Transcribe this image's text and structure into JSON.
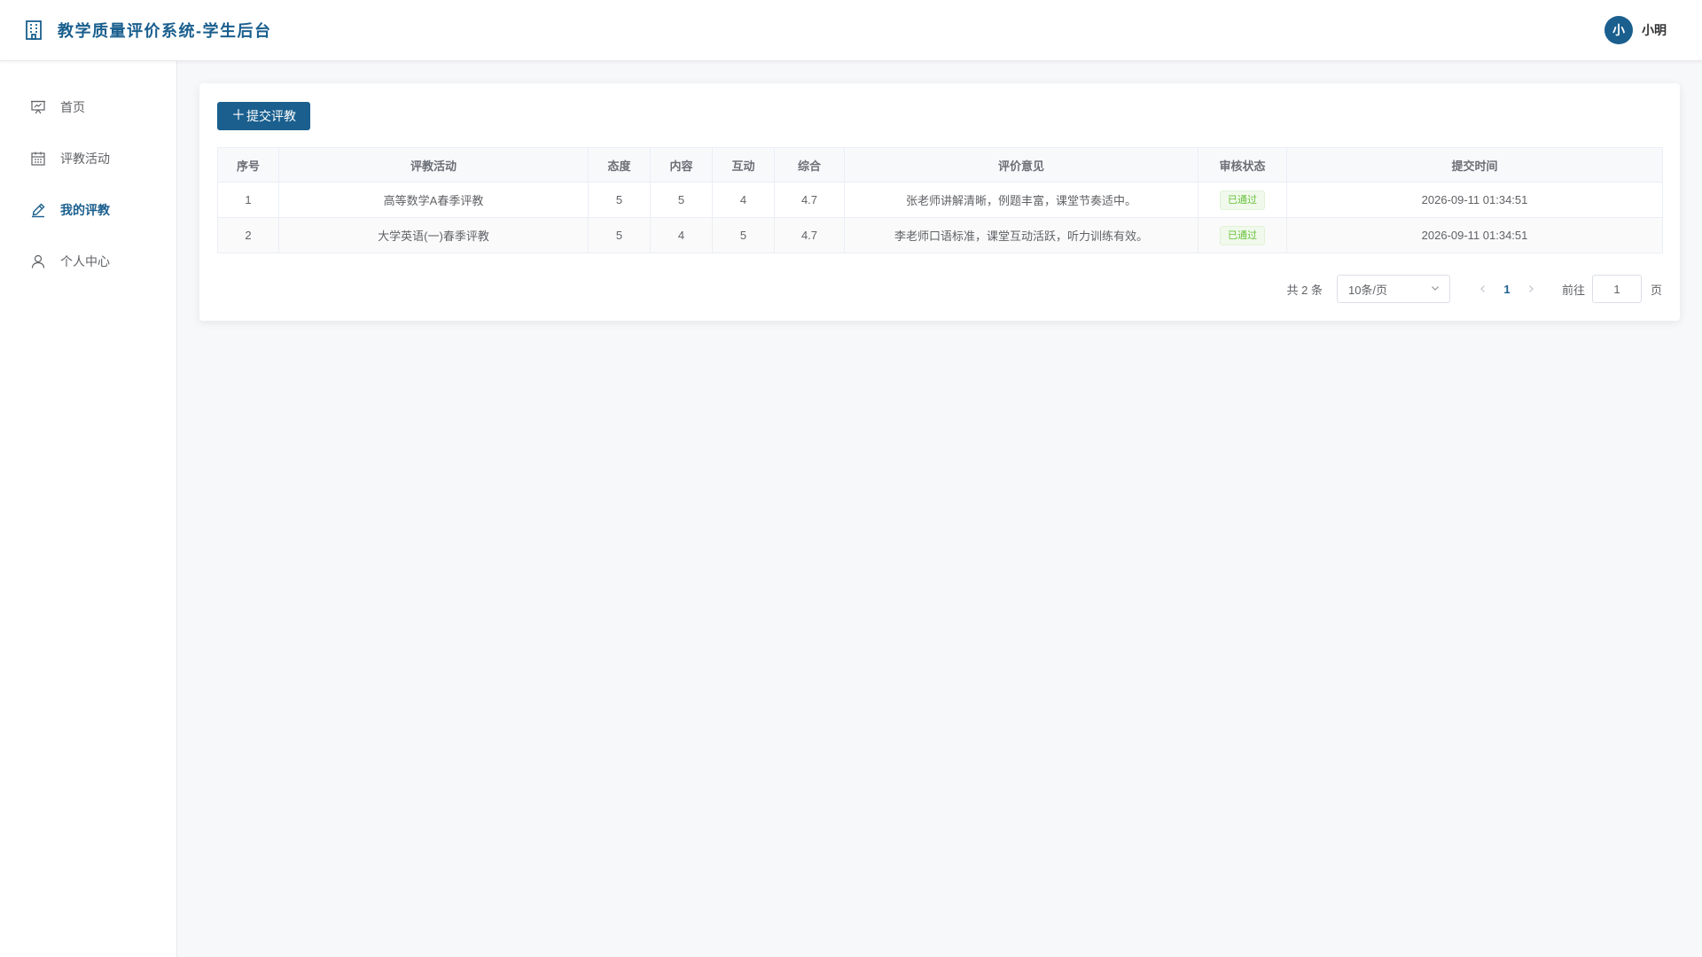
{
  "app": {
    "title": "教学质量评价系统-学生后台",
    "accent": "#1a5f8e",
    "icon": "building-icon"
  },
  "user": {
    "avatar_text": "小",
    "name": "小明"
  },
  "sidebar": {
    "items": [
      {
        "label": "首页",
        "icon": "presentation-icon",
        "active": false
      },
      {
        "label": "评教活动",
        "icon": "calendar-icon",
        "active": false
      },
      {
        "label": "我的评教",
        "icon": "pen-icon",
        "active": true
      },
      {
        "label": "个人中心",
        "icon": "user-icon",
        "active": false
      }
    ]
  },
  "toolbar": {
    "submit_label": "提交评教",
    "submit_icon": "plus-icon"
  },
  "table": {
    "headers": [
      "序号",
      "评教活动",
      "态度",
      "内容",
      "互动",
      "综合",
      "评价意见",
      "审核状态",
      "提交时间"
    ],
    "rows": [
      {
        "index": "1",
        "activity": "高等数学A春季评教",
        "attitude": "5",
        "content": "5",
        "interaction": "4",
        "overall": "4.7",
        "comment": "张老师讲解清晰，例题丰富，课堂节奏适中。",
        "status": "已通过",
        "time": "2026-09-11 01:34:51"
      },
      {
        "index": "2",
        "activity": "大学英语(一)春季评教",
        "attitude": "5",
        "content": "4",
        "interaction": "5",
        "overall": "4.7",
        "comment": "李老师口语标准，课堂互动活跃，听力训练有效。",
        "status": "已通过",
        "time": "2026-09-11 01:34:51"
      }
    ]
  },
  "pagination": {
    "total": "共 2 条",
    "page_size": "10条/页",
    "current": "1",
    "goto_label": "前往",
    "goto_value": "1",
    "page_suffix": "页"
  },
  "colors": {
    "success": "#67c23a",
    "success_bg": "#f0f9eb"
  }
}
